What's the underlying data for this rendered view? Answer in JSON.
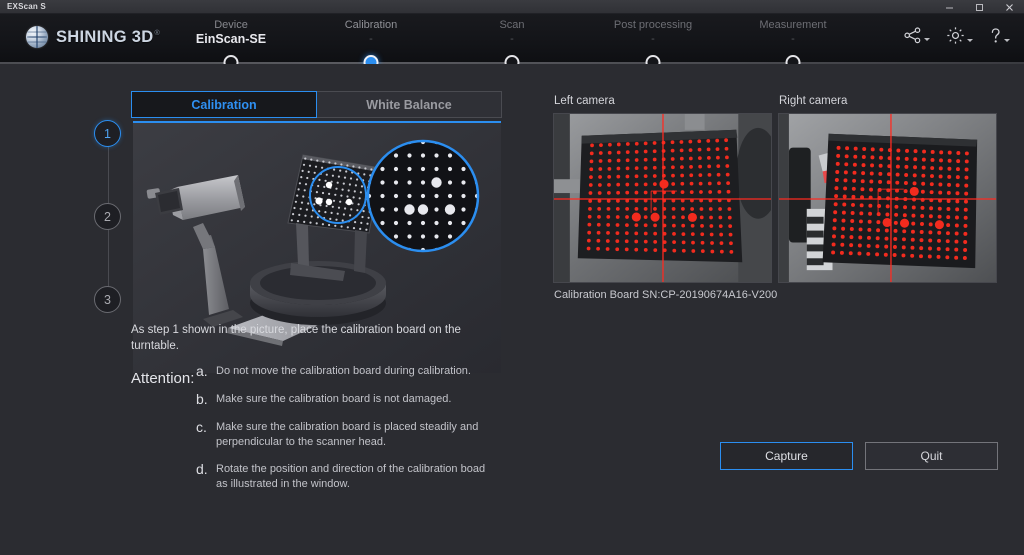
{
  "window": {
    "title": "EXScan S",
    "controls": [
      {
        "name": "minimize",
        "glyph": "–"
      },
      {
        "name": "maximize",
        "glyph": "□"
      },
      {
        "name": "close",
        "glyph": "×"
      }
    ]
  },
  "header": {
    "brand": "SHINING 3D",
    "brand_mark": "®",
    "icons": [
      {
        "name": "share-icon",
        "label": "Share"
      },
      {
        "name": "gear-icon",
        "label": "Settings"
      },
      {
        "name": "help-icon",
        "label": "Help"
      }
    ],
    "steps": [
      {
        "label": "Device",
        "sub": "EinScan-SE",
        "active": false
      },
      {
        "label": "Calibration",
        "sub": "-",
        "active": true
      },
      {
        "label": "Scan",
        "sub": "-",
        "active": false
      },
      {
        "label": "Post processing",
        "sub": "-",
        "active": false
      },
      {
        "label": "Measurement",
        "sub": "-",
        "active": false
      }
    ]
  },
  "main": {
    "tabs": [
      {
        "label": "Calibration",
        "active": true
      },
      {
        "label": "White Balance",
        "active": false
      }
    ],
    "rail": [
      {
        "number": "1",
        "active": true
      },
      {
        "number": "2",
        "active": false
      },
      {
        "number": "3",
        "active": false
      }
    ],
    "instruction": "As step 1 shown in the picture, place the calibration board on the turntable.",
    "attention_label": "Attention:",
    "attention_items": [
      {
        "letter": "a.",
        "text": "Do not move the calibration board during calibration."
      },
      {
        "letter": "b.",
        "text": "Make sure the calibration board is not damaged."
      },
      {
        "letter": "c.",
        "text": "Make sure the calibration board is placed steadily and perpendicular to the scanner head."
      },
      {
        "letter": "d.",
        "text": "Rotate the position and direction of the calibration boad as illustrated in the window."
      }
    ]
  },
  "cameras": {
    "left_label": "Left camera",
    "right_label": "Right camera",
    "serial_text": "Calibration Board SN:CP-20190674A16-V200"
  },
  "actions": {
    "capture": "Capture",
    "quit": "Quit"
  },
  "colors": {
    "accent": "#2b8ef0",
    "background": "#2b2c31",
    "header": "#141519",
    "marker": "#ff2a20"
  }
}
